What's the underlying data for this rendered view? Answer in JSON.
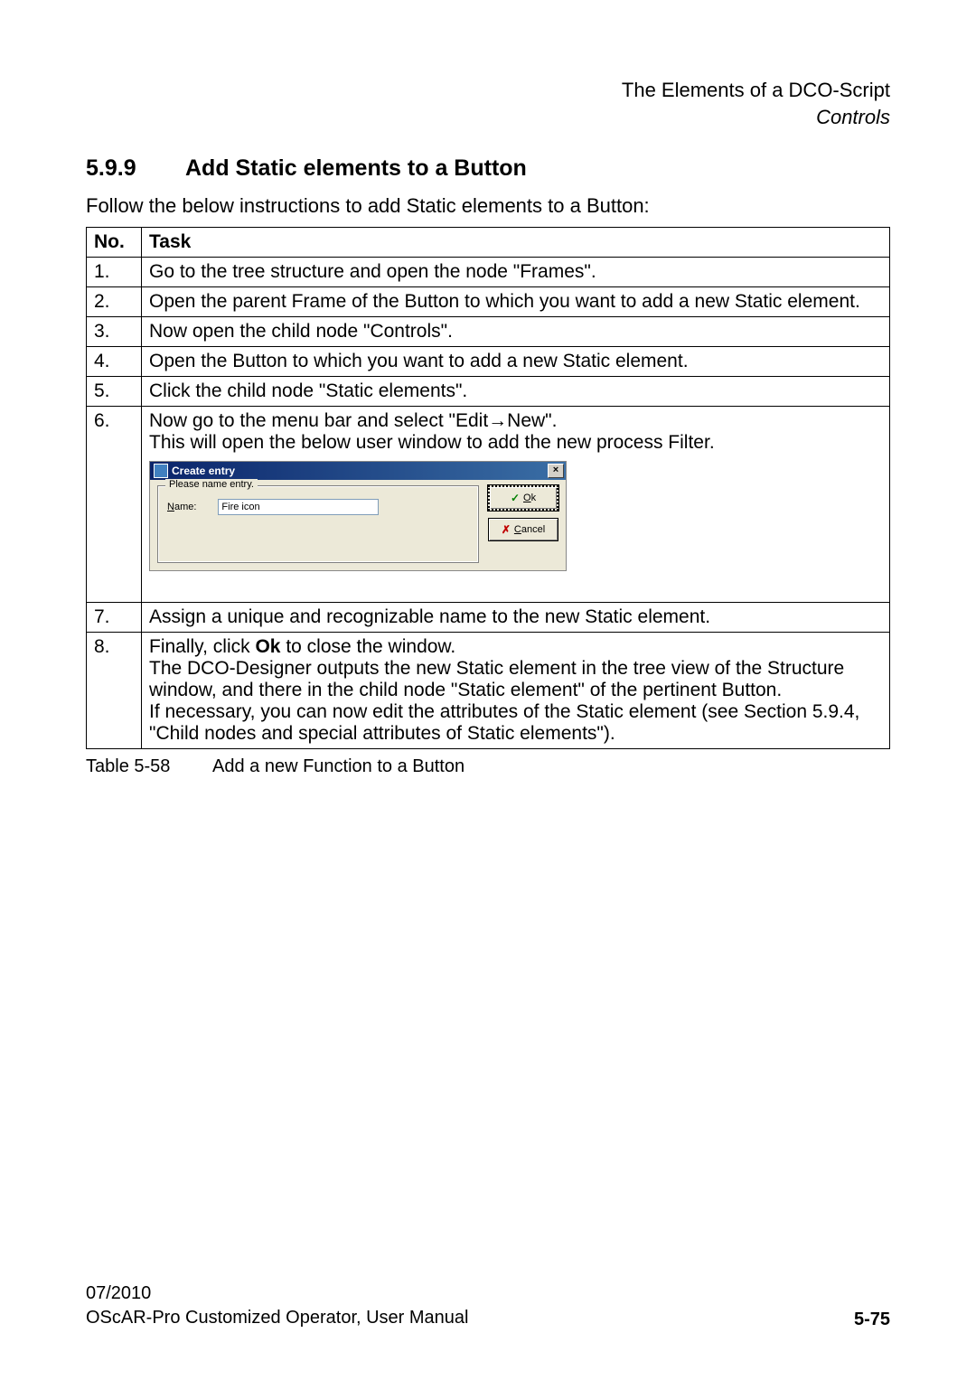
{
  "header": {
    "title": "The Elements of a DCO-Script",
    "subtitle": "Controls"
  },
  "section": {
    "number": "5.9.9",
    "title": "Add Static elements to a Button",
    "intro": "Follow the below instructions to add Static elements to a Button:"
  },
  "table": {
    "head": {
      "no": "No.",
      "task": "Task"
    },
    "rows": {
      "r1": {
        "no": "1.",
        "task": "Go to the tree structure and open the node \"Frames\"."
      },
      "r2": {
        "no": "2.",
        "task": "Open the parent Frame of the Button to which you want to add a new Static element."
      },
      "r3": {
        "no": "3.",
        "task": "Now open the child node \"Controls\"."
      },
      "r4": {
        "no": "4.",
        "task": "Open the Button to which you want to add a new Static element."
      },
      "r5": {
        "no": "5.",
        "task": "Click the child node \"Static elements\"."
      },
      "r6": {
        "no": "6.",
        "line1": "Now go to the menu bar and select \"Edit→New\".",
        "line2": "This will open the below user window to add the new process Filter."
      },
      "r7": {
        "no": "7.",
        "task": "Assign a unique and recognizable name to the new Static element."
      },
      "r8": {
        "no": "8.",
        "l1a": "Finally, click ",
        "l1b": "Ok",
        "l1c": " to close the window.",
        "l2": "The DCO-Designer outputs the new Static element in the tree view of the Structure window, and there in the child node \"Static element\" of the pertinent Button.",
        "l3": "If necessary, you can now edit the attributes of the Static element (see Section 5.9.4, \"Child nodes and special attributes of Static elements\")."
      }
    }
  },
  "dialog": {
    "title": "Create entry",
    "close": "×",
    "group_legend": "Please name entry.",
    "name_label_ul": "N",
    "name_label_rest": "ame:",
    "name_value": "Fire icon",
    "ok_label_ul": "O",
    "ok_label_rest": "k",
    "cancel_label_ul": "C",
    "cancel_label_rest": "ancel"
  },
  "caption": {
    "label": "Table 5-58",
    "text": "Add a new Function to a Button"
  },
  "footer": {
    "date": "07/2010",
    "doc": "OScAR-Pro Customized Operator, User Manual",
    "page": "5-75"
  }
}
